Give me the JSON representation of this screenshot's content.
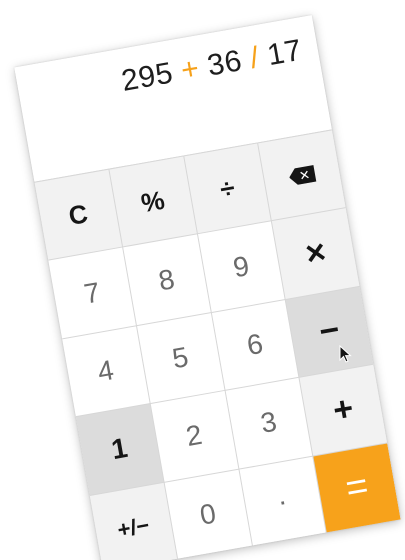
{
  "display": {
    "expression_parts": [
      {
        "text": "295 ",
        "kind": "num"
      },
      {
        "text": "+",
        "kind": "op"
      },
      {
        "text": " 36 ",
        "kind": "num"
      },
      {
        "text": "/",
        "kind": "op"
      },
      {
        "text": " 17",
        "kind": "num"
      }
    ]
  },
  "colors": {
    "accent": "#f6a11a",
    "pressed": "#dcdcdc",
    "function_key_bg": "#f2f2f2"
  },
  "keys": {
    "clear": "C",
    "percent": "%",
    "divide": "÷",
    "backspace_glyph": "✕",
    "multiply": "×",
    "minus": "−",
    "plus": "+",
    "equals": "=",
    "sign": "+/−",
    "decimal": "·",
    "d0": "0",
    "d1": "1",
    "d2": "2",
    "d3": "3",
    "d4": "4",
    "d5": "5",
    "d6": "6",
    "d7": "7",
    "d8": "8",
    "d9": "9"
  },
  "state": {
    "pressed_keys": [
      "1",
      "−"
    ]
  }
}
